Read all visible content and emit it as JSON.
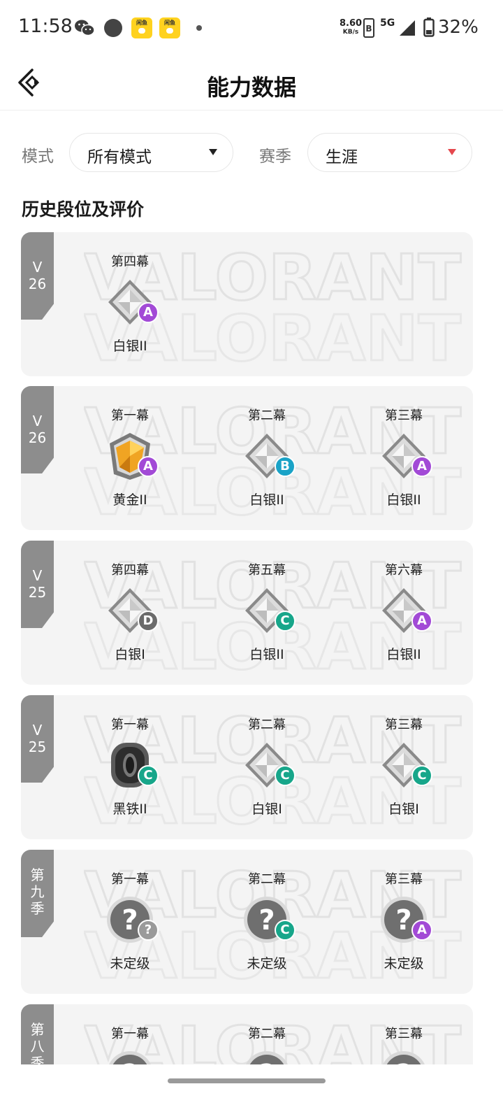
{
  "status_bar": {
    "time": "11:58",
    "net_speed": "8.60",
    "net_unit": "KB/s",
    "network": "5G",
    "battery": "32%",
    "icons": [
      "wechat-icon",
      "circle-dot-icon",
      "app-badge-icon",
      "app-badge-icon",
      "dot-icon",
      "sim-icon",
      "signal-icon",
      "battery-icon"
    ],
    "app_badge_text": "闲鱼"
  },
  "header": {
    "title": "能力数据",
    "back_icon": "back-arrow-icon"
  },
  "filters": {
    "mode_label": "模式",
    "mode_value": "所有模式",
    "season_label": "赛季",
    "season_value": "生涯",
    "mode_arrow_color": "#222222",
    "season_arrow_color": "#e5484d"
  },
  "section_title": "历史段位及评价",
  "watermark_text": "VALORANT",
  "grade_colors": {
    "A": "#a24ad6",
    "B": "#1aa3c7",
    "C": "#17a68a",
    "D": "#6b6b6b",
    "?": "#9a9a9a"
  },
  "cards": [
    {
      "tag": "V\n26",
      "acts": [
        {
          "label": "第四幕",
          "rank": "白银II",
          "icon": "silver-rank-icon",
          "grade": "A"
        }
      ]
    },
    {
      "tag": "V\n26",
      "acts": [
        {
          "label": "第一幕",
          "rank": "黄金II",
          "icon": "gold-rank-icon",
          "grade": "A"
        },
        {
          "label": "第二幕",
          "rank": "白银II",
          "icon": "silver-rank-icon",
          "grade": "B"
        },
        {
          "label": "第三幕",
          "rank": "白银II",
          "icon": "silver-rank-icon",
          "grade": "A"
        }
      ]
    },
    {
      "tag": "V\n25",
      "acts": [
        {
          "label": "第四幕",
          "rank": "白银I",
          "icon": "silver-rank-icon",
          "grade": "D"
        },
        {
          "label": "第五幕",
          "rank": "白银II",
          "icon": "silver-rank-icon",
          "grade": "C"
        },
        {
          "label": "第六幕",
          "rank": "白银II",
          "icon": "silver-rank-icon",
          "grade": "A"
        }
      ]
    },
    {
      "tag": "V\n25",
      "acts": [
        {
          "label": "第一幕",
          "rank": "黑铁II",
          "icon": "iron-rank-icon",
          "grade": "C"
        },
        {
          "label": "第二幕",
          "rank": "白银I",
          "icon": "silver-rank-icon",
          "grade": "C"
        },
        {
          "label": "第三幕",
          "rank": "白银I",
          "icon": "silver-rank-icon",
          "grade": "C"
        }
      ]
    },
    {
      "tag": "第\n九\n季",
      "acts": [
        {
          "label": "第一幕",
          "rank": "未定级",
          "icon": "unranked-icon",
          "grade": "?"
        },
        {
          "label": "第二幕",
          "rank": "未定级",
          "icon": "unranked-icon",
          "grade": "C"
        },
        {
          "label": "第三幕",
          "rank": "未定级",
          "icon": "unranked-icon",
          "grade": "A"
        }
      ]
    },
    {
      "tag": "第\n八\n季",
      "acts": [
        {
          "label": "第一幕",
          "rank": "",
          "icon": "unranked-icon",
          "grade": ""
        },
        {
          "label": "第二幕",
          "rank": "",
          "icon": "unranked-icon",
          "grade": ""
        },
        {
          "label": "第三幕",
          "rank": "",
          "icon": "unranked-icon",
          "grade": ""
        }
      ]
    }
  ]
}
